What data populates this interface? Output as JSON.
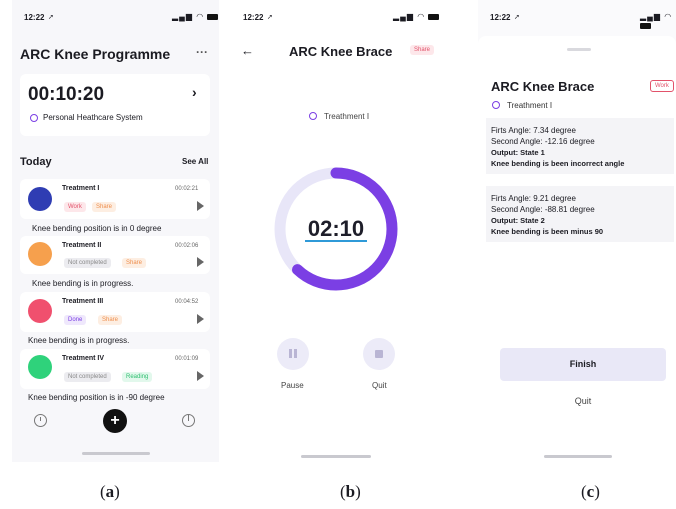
{
  "screen_a": {
    "status_time": "12:22",
    "title": "ARC Knee Programme",
    "more": "···",
    "timer_card": {
      "time": "00:10:20",
      "system": "Personal Heathcare System"
    },
    "today_label": "Today",
    "see_all": "See All",
    "treatments": [
      {
        "name": "Treatment I",
        "time": "00:02:21",
        "tags": [
          "Work",
          "Share"
        ],
        "note": "Knee bending position is in 0 degree",
        "color": "#2f3db3"
      },
      {
        "name": "Treatment II",
        "time": "00:02:06",
        "tags": [
          "Not completed",
          "Share"
        ],
        "note": "Knee bending is in progress.",
        "color": "#f6a04d"
      },
      {
        "name": "Treatment III",
        "time": "00:04:52",
        "tags": [
          "Done",
          "Share"
        ],
        "note": "Knee bending is in progress.",
        "color": "#f0506e"
      },
      {
        "name": "Treatment IV",
        "time": "00:01:09",
        "tags": [
          "Not completed",
          "Reading"
        ],
        "note": "Knee bending position is in -90 degree",
        "color": "#2fd27b"
      }
    ],
    "fab_icon": "plus-icon"
  },
  "screen_b": {
    "status_time": "12:22",
    "title": "ARC Knee Brace",
    "share_label": "Share",
    "treatment_label": "Treathment I",
    "timer": "02:10",
    "progress_fraction": 0.62,
    "pause_label": "Pause",
    "quit_label": "Quit"
  },
  "screen_c": {
    "status_time": "12:22",
    "title": "ARC Knee Brace",
    "work_label": "Work",
    "treatment_label": "Treathment I",
    "results": [
      {
        "first": "Firts Angle: 7.34 degree",
        "second": "Second Angle: -12.16 degree",
        "output": "Output: State 1",
        "message": "Knee bending is been incorrect angle"
      },
      {
        "first": "Firts Angle: 9.21 degree",
        "second": "Second Angle: -88.81 degree",
        "output": "Output: State 2",
        "message": "Knee bending is been minus 90"
      }
    ],
    "finish_label": "Finish",
    "quit_label": "Quit"
  },
  "captions": {
    "a": "a",
    "b": "b",
    "c": "c"
  },
  "colors": {
    "accent": "#7b3fe4",
    "ring_track": "#e8e6f8",
    "tag_red_bg": "#fde7ea",
    "tag_red": "#e2526a"
  }
}
